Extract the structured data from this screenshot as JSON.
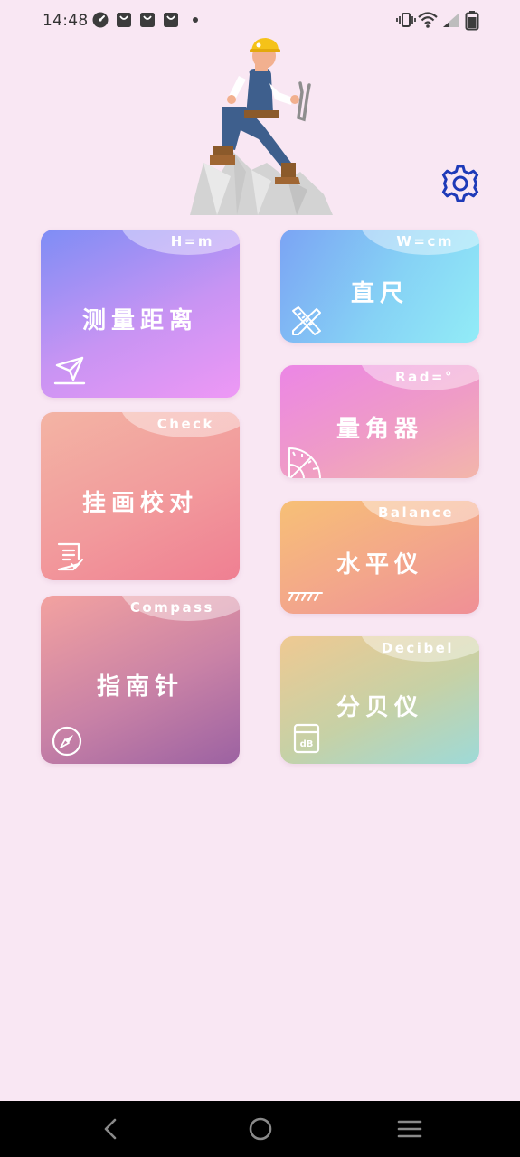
{
  "status_bar": {
    "time": "14:48",
    "notification_icons": [
      "speed-icon",
      "shopping-bag-icon",
      "shopping-bag-icon",
      "shopping-bag-icon",
      "dot-icon"
    ],
    "system_icons": [
      "vibrate-icon",
      "wifi-icon",
      "signal-icon",
      "battery-icon"
    ]
  },
  "colors": {
    "background": "#f9e7f3",
    "settings_icon": "#1e3ab8"
  },
  "cards": {
    "distance": {
      "code": "H=m",
      "title": "测量距离",
      "icon": "send-icon"
    },
    "ruler": {
      "code": "W=cm",
      "title": "直尺",
      "icon": "ruler-pencil-icon"
    },
    "picture_check": {
      "code": "Check",
      "title": "挂画校对",
      "icon": "checklist-icon"
    },
    "protractor": {
      "code": "Rad=°",
      "title": "量角器",
      "icon": "protractor-icon"
    },
    "level": {
      "code": "Balance",
      "title": "水平仪",
      "icon": "level-ruler-icon"
    },
    "compass": {
      "code": "Compass",
      "title": "指南针",
      "icon": "compass-icon"
    },
    "decibel": {
      "code": "Decibel",
      "title": "分贝仪",
      "icon": "decibel-meter-icon"
    }
  },
  "nav_bar": {
    "buttons": [
      "back-icon",
      "home-icon",
      "menu-icon"
    ]
  }
}
